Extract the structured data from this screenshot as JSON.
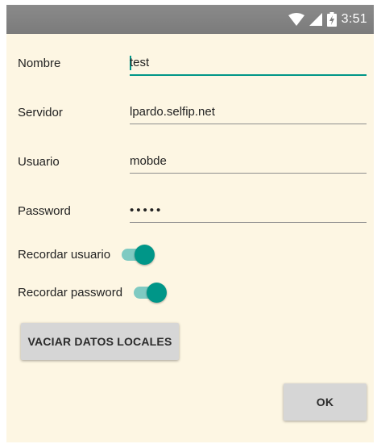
{
  "status_bar": {
    "time": "3:51",
    "icons": [
      "wifi-icon",
      "signal-icon",
      "battery-charging-icon"
    ]
  },
  "form": {
    "nombre": {
      "label": "Nombre",
      "value": "test"
    },
    "servidor": {
      "label": "Servidor",
      "value": "lpardo.selfip.net"
    },
    "usuario": {
      "label": "Usuario",
      "value": "mobde"
    },
    "password": {
      "label": "Password",
      "value": "•••••"
    }
  },
  "switches": {
    "recordar_usuario": {
      "label": "Recordar usuario",
      "on": true
    },
    "recordar_password": {
      "label": "Recordar password",
      "on": true
    }
  },
  "buttons": {
    "vaciar": "VACIAR DATOS LOCALES",
    "ok": "OK"
  },
  "colors": {
    "accent": "#009688",
    "background": "#fdf6e3",
    "status_bar": "#808080"
  }
}
